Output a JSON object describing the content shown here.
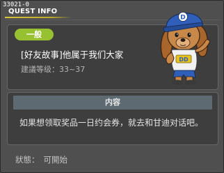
{
  "window": {
    "id_label": "33021-0",
    "title": "QUEST INFO"
  },
  "quest": {
    "badge": "一般",
    "name": "[好友故事]他属于我们大家",
    "level_range": "建議等级：33~37"
  },
  "content": {
    "header": "内容",
    "text": "如果想领取奖品一日约会券，就去和甘迪对话吧。"
  },
  "status": {
    "label": "狀態：",
    "value": "可開始"
  },
  "character": {
    "cap_text": "D",
    "shirt_text": "DD"
  },
  "colors": {
    "window_bg": "#4f4f4f",
    "panel_bg": "#3e3e3e",
    "badge": "#98c132",
    "header_bar": "#5d6a72",
    "title_rule": "#d8c53a"
  },
  "icons": [
    "dog-character-icon"
  ]
}
